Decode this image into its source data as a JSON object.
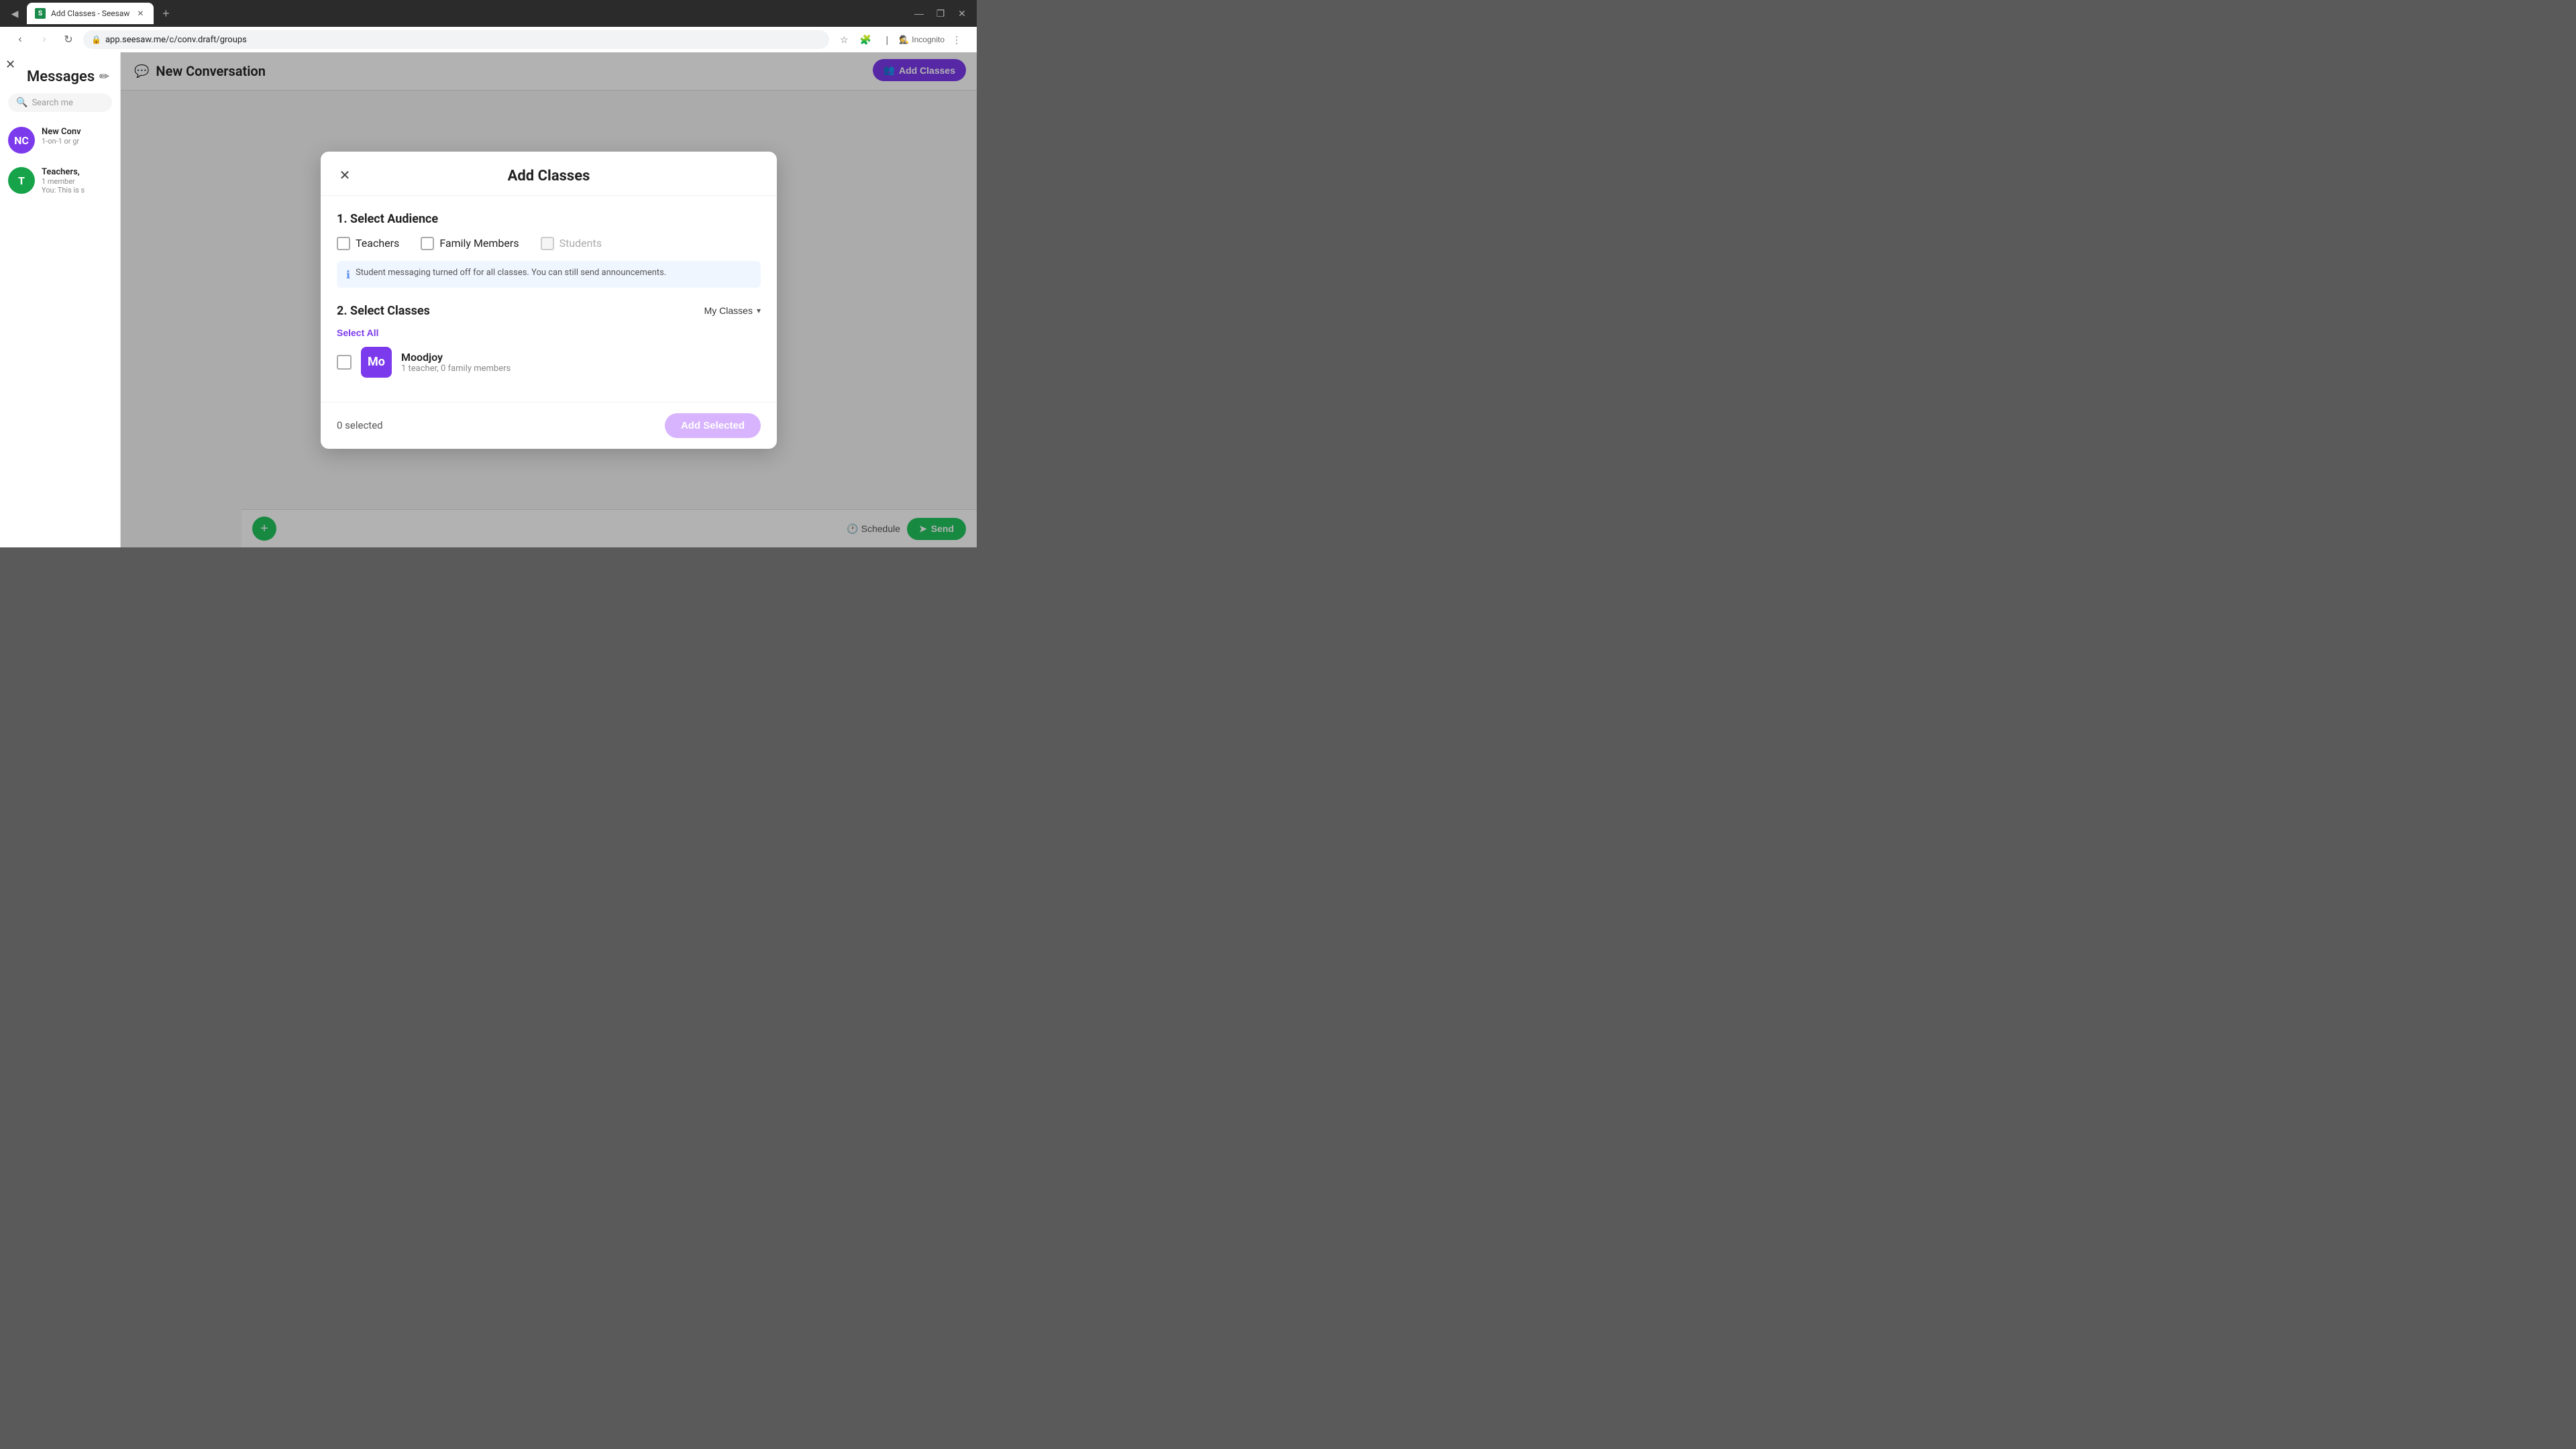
{
  "browser": {
    "tab_favicon": "S",
    "tab_title": "Add Classes - Seesaw",
    "url": "app.seesaw.me/c/conv.draft/groups",
    "incognito_label": "Incognito"
  },
  "sidebar": {
    "close_icon": "✕",
    "title": "Messages",
    "compose_icon": "✏",
    "search_placeholder": "Search me",
    "conversations": [
      {
        "name": "New Conv",
        "subtitle": "1-on-1 or gr",
        "avatar_bg": "#7c3aed",
        "avatar_text": "NC"
      },
      {
        "name": "Teachers,",
        "subtitle": "1 member",
        "preview": "You: This is s",
        "avatar_bg": "#16a34a",
        "avatar_text": "T"
      }
    ]
  },
  "new_conversation": {
    "icon": "💬",
    "title": "New Conversation"
  },
  "add_classes_top_button": {
    "icon": "👥",
    "label": "Add Classes"
  },
  "bottom_bar": {
    "schedule_label": "Schedule",
    "send_label": "Send"
  },
  "modal": {
    "close_icon": "✕",
    "title": "Add Classes",
    "section1_title": "1. Select Audience",
    "audience_options": [
      {
        "label": "Teachers",
        "checked": false,
        "disabled": false
      },
      {
        "label": "Family Members",
        "checked": false,
        "disabled": false
      },
      {
        "label": "Students",
        "checked": false,
        "disabled": true
      }
    ],
    "info_text": "Student messaging turned off for all classes. You can still send announcements.",
    "section2_title": "2. Select Classes",
    "select_all_label": "Select All",
    "my_classes_label": "My Classes",
    "classes": [
      {
        "name": "Moodjoy",
        "description": "1 teacher, 0 family members",
        "avatar_bg": "#7c3aed",
        "avatar_text": "Mo",
        "checked": false
      }
    ],
    "selected_count": "0 selected",
    "add_selected_label": "Add Selected"
  }
}
